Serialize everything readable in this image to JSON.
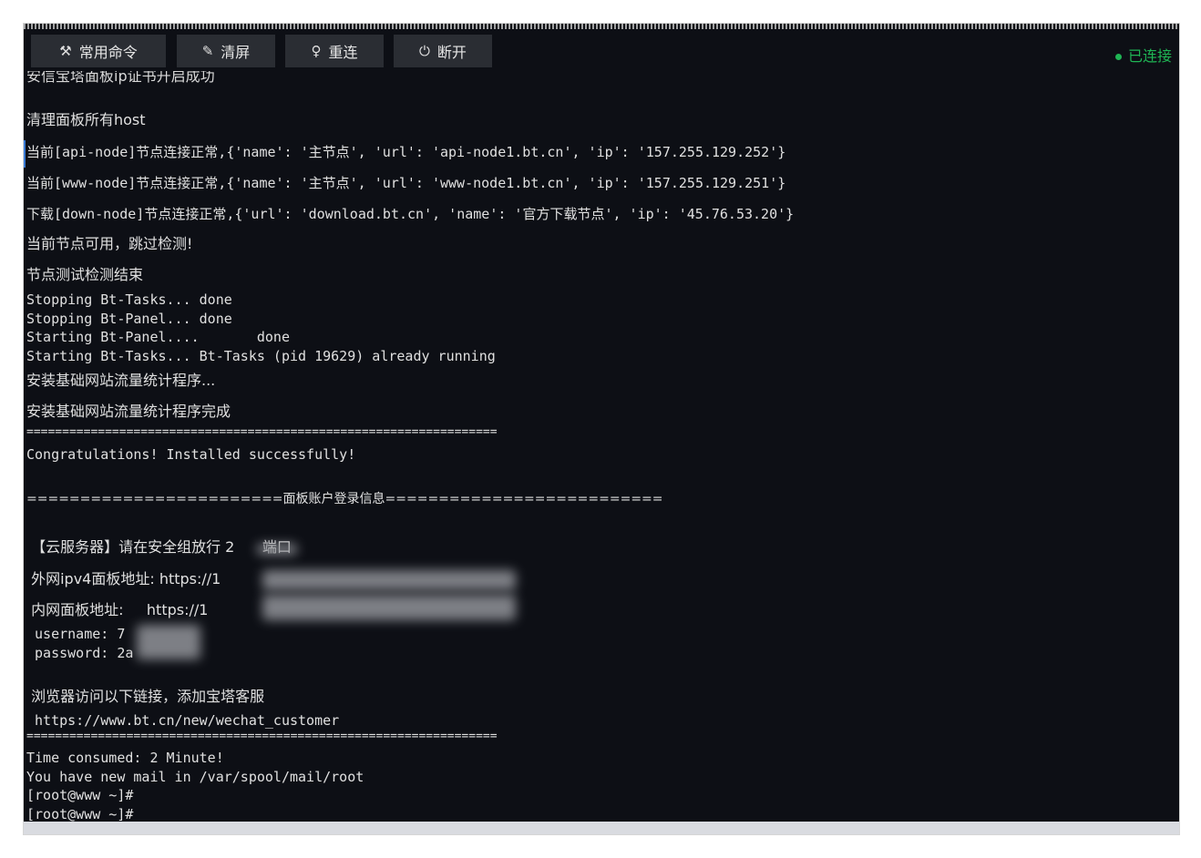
{
  "toolbar": {
    "buttons": [
      {
        "label": "常用命令",
        "icon": "tools-icon",
        "glyph": "⚒"
      },
      {
        "label": "清屏",
        "icon": "brush-icon",
        "glyph": "✎"
      },
      {
        "label": "重连",
        "icon": "bulb-icon",
        "glyph": "♀"
      },
      {
        "label": "断开",
        "icon": "power-icon",
        "glyph": "⏻"
      }
    ],
    "status": "已连接",
    "status_color": "#1fb554"
  },
  "terminal": {
    "partial_top": "安信宝塔面板ip证书开启成功",
    "lines": [
      "清理面板所有host",
      "当前[api-node]节点连接正常,{'name': '主节点', 'url': 'api-node1.bt.cn', 'ip': '157.255.129.252'}",
      "当前[www-node]节点连接正常,{'name': '主节点', 'url': 'www-node1.bt.cn', 'ip': '157.255.129.251'}",
      "下载[down-node]节点连接正常,{'url': 'download.bt.cn', 'name': '官方下载节点', 'ip': '45.76.53.20'}",
      "当前节点可用，跳过检测!",
      "节点测试检测结束",
      "Stopping Bt-Tasks... done",
      "Stopping Bt-Panel... done",
      "Starting Bt-Panel....       done",
      "Starting Bt-Tasks... Bt-Tasks (pid 19629) already running",
      "安装基础网站流量统计程序...",
      "安装基础网站流量统计程序完成",
      "==================================================================",
      "Congratulations! Installed successfully!",
      "========================面板账户登录信息==========================",
      " 【云服务器】请在安全组放行 2      端口",
      " 外网ipv4面板地址: https://1",
      " 内网面板地址:     https://1",
      " username: 7",
      " password: 2a",
      " 浏览器访问以下链接，添加宝塔客服",
      " https://www.bt.cn/new/wechat_customer",
      "==================================================================",
      "Time consumed: 2 Minute!",
      "You have new mail in /var/spool/mail/root",
      "[root@www ~]#",
      "[root@www ~]#"
    ]
  }
}
